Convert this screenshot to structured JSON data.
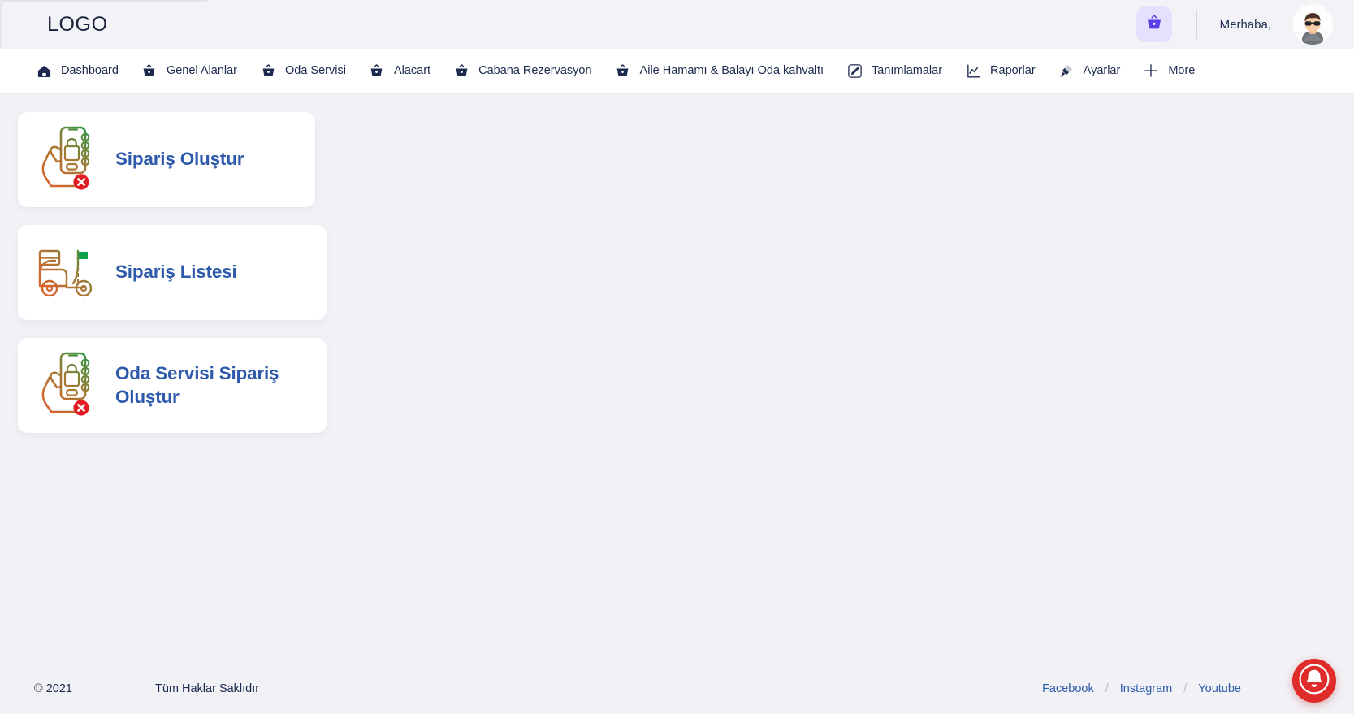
{
  "header": {
    "logo": "LOGO",
    "basket_icon": "basket-icon",
    "greeting": "Merhaba,",
    "avatar_icon": "user-avatar"
  },
  "nav": {
    "items": [
      {
        "label": "Dashboard",
        "icon": "home-icon"
      },
      {
        "label": "Genel Alanlar",
        "icon": "basket-icon"
      },
      {
        "label": "Oda Servisi",
        "icon": "basket-icon"
      },
      {
        "label": "Alacart",
        "icon": "basket-icon"
      },
      {
        "label": "Cabana Rezervasyon",
        "icon": "basket-icon"
      },
      {
        "label": "Aile Hamamı & Balayı Oda kahvaltı",
        "icon": "basket-icon"
      },
      {
        "label": "Tanımlamalar",
        "icon": "edit-pencil-icon"
      },
      {
        "label": "Raporlar",
        "icon": "chart-line-icon"
      },
      {
        "label": "Ayarlar",
        "icon": "paintbrush-icon"
      },
      {
        "label": "More",
        "icon": "plus-icon"
      }
    ]
  },
  "main": {
    "cards": [
      {
        "title": "Sipariş Oluştur",
        "icon": "hand-phone-order-icon"
      },
      {
        "title": "Sipariş Listesi",
        "icon": "delivery-scooter-icon"
      },
      {
        "title": "Oda Servisi Sipariş Oluştur",
        "icon": "hand-phone-order-icon"
      }
    ]
  },
  "footer": {
    "copyright": "© 2021",
    "rights": "Tüm Haklar Saklıdır",
    "links": [
      "Facebook",
      "Instagram",
      "Youtube"
    ],
    "separator": "/",
    "fab_icon": "notification-bell-icon"
  },
  "colors": {
    "page_bg": "#f1f1f6",
    "header_bg": "#f2f2f7",
    "nav_bg": "#ffffff",
    "nav_text": "#1b2a4e",
    "card_title": "#2e5aac",
    "basket_accent": "#5b3ee8",
    "basket_chip_bg": "#e5e0fd",
    "link": "#2f5dae",
    "fab": "#e02b2b",
    "icon_gradient_start": "#f05a28",
    "icon_gradient_end": "#0ba04a"
  }
}
